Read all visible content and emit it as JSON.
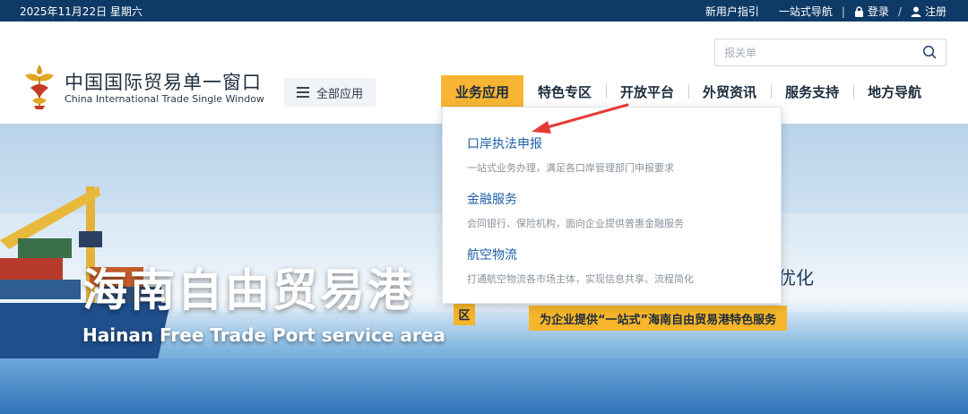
{
  "topbar": {
    "date": "2025年11月22日 星期六",
    "new_user_guide": "新用户指引",
    "one_stop_nav": "一站式导航",
    "divider": "|",
    "login": "登录",
    "slash": "/",
    "register": "注册"
  },
  "brand": {
    "name_cn": "中国国际贸易单一窗口",
    "name_en": "China International Trade Single Window"
  },
  "search": {
    "placeholder": "报关单"
  },
  "all_apps": {
    "label": "全部应用"
  },
  "nav": {
    "items": [
      {
        "label": "业务应用"
      },
      {
        "label": "特色专区"
      },
      {
        "label": "开放平台"
      },
      {
        "label": "外贸资讯"
      },
      {
        "label": "服务支持"
      },
      {
        "label": "地方导航"
      }
    ]
  },
  "dropdown": {
    "items": [
      {
        "title": "口岸执法申报",
        "desc": "一站式业务办理，满足各口岸管理部门申报要求"
      },
      {
        "title": "金融服务",
        "desc": "会同银行、保险机构，面向企业提供普惠金融服务"
      },
      {
        "title": "航空物流",
        "desc": "打通航空物流各市场主体，实现信息共享、流程简化"
      }
    ]
  },
  "banner": {
    "title_cn": "海南自由贸易港",
    "title_en": "Hainan Free Trade Port service area",
    "right_text": "程优化",
    "tag": "区",
    "cta": "为企业提供“一站式”海南自由贸易港特色服务"
  },
  "colors": {
    "topbar_bg": "#0e3a66",
    "nav_active": "#f7b533",
    "link_blue": "#1e5fa6",
    "arrow_red": "#e53935"
  },
  "icons": [
    "logo-emblem-icon",
    "menu-icon",
    "search-icon",
    "lock-icon",
    "user-icon",
    "red-arrow-icon"
  ]
}
